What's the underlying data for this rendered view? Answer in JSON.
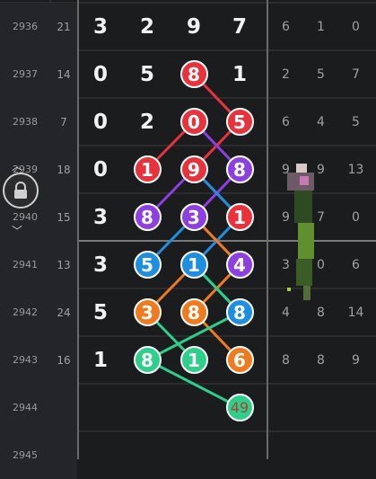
{
  "rows": [
    {
      "period": "2936",
      "sum": "21",
      "digits": [
        "3",
        "2",
        "9",
        "7"
      ],
      "ext": [
        "6",
        "1",
        "0"
      ]
    },
    {
      "period": "2937",
      "sum": "14",
      "digits": [
        "0",
        "5",
        "8",
        "1"
      ],
      "ext": [
        "2",
        "5",
        "7"
      ]
    },
    {
      "period": "2938",
      "sum": "7",
      "digits": [
        "0",
        "2",
        "0",
        "5"
      ],
      "ext": [
        "6",
        "4",
        "5"
      ]
    },
    {
      "period": "2939",
      "sum": "18",
      "digits": [
        "0",
        "1",
        "9",
        "8"
      ],
      "ext": [
        "9",
        "9",
        "13"
      ]
    },
    {
      "period": "2940",
      "sum": "15",
      "digits": [
        "3",
        "8",
        "3",
        "1"
      ],
      "ext": [
        "9",
        "7",
        "0"
      ]
    },
    {
      "period": "2941",
      "sum": "13",
      "digits": [
        "3",
        "5",
        "1",
        "4"
      ],
      "ext": [
        "3",
        "0",
        "6"
      ]
    },
    {
      "period": "2942",
      "sum": "24",
      "digits": [
        "5",
        "3",
        "8",
        "8"
      ],
      "ext": [
        "4",
        "8",
        "14"
      ]
    },
    {
      "period": "2943",
      "sum": "16",
      "digits": [
        "1",
        "8",
        "1",
        "6"
      ],
      "ext": [
        "8",
        "8",
        "9"
      ]
    },
    {
      "period": "2944",
      "sum": "",
      "digits": [
        "",
        "",
        "",
        "49"
      ],
      "ext": [
        "",
        "",
        ""
      ]
    },
    {
      "period": "2945",
      "sum": "",
      "digits": [
        "",
        "",
        "",
        ""
      ],
      "ext": [
        "",
        "",
        ""
      ]
    }
  ],
  "balls": [
    {
      "row": 1,
      "col": 2,
      "label": "8",
      "color": "#e8323c"
    },
    {
      "row": 2,
      "col": 2,
      "label": "0",
      "color": "#e8323c"
    },
    {
      "row": 2,
      "col": 3,
      "label": "5",
      "color": "#e8323c"
    },
    {
      "row": 3,
      "col": 1,
      "label": "1",
      "color": "#e8323c"
    },
    {
      "row": 3,
      "col": 2,
      "label": "9",
      "color": "#e8323c"
    },
    {
      "row": 3,
      "col": 3,
      "label": "8",
      "color": "#8e3fe0"
    },
    {
      "row": 4,
      "col": 1,
      "label": "8",
      "color": "#8e3fe0"
    },
    {
      "row": 4,
      "col": 2,
      "label": "3",
      "color": "#8e3fe0"
    },
    {
      "row": 4,
      "col": 3,
      "label": "1",
      "color": "#e8323c"
    },
    {
      "row": 5,
      "col": 1,
      "label": "5",
      "color": "#1e8ee0"
    },
    {
      "row": 5,
      "col": 2,
      "label": "1",
      "color": "#1e8ee0"
    },
    {
      "row": 5,
      "col": 3,
      "label": "4",
      "color": "#8e3fe0"
    },
    {
      "row": 6,
      "col": 1,
      "label": "3",
      "color": "#f07a1e"
    },
    {
      "row": 6,
      "col": 2,
      "label": "8",
      "color": "#f07a1e"
    },
    {
      "row": 6,
      "col": 3,
      "label": "8",
      "color": "#1e8ee0"
    },
    {
      "row": 7,
      "col": 1,
      "label": "8",
      "color": "#2ecf8a"
    },
    {
      "row": 7,
      "col": 2,
      "label": "1",
      "color": "#2ecf8a"
    },
    {
      "row": 7,
      "col": 3,
      "label": "6",
      "color": "#f07a1e"
    },
    {
      "row": 8,
      "col": 3,
      "label": "49",
      "color": "#2ecf8a",
      "bottom": true
    }
  ],
  "lines": [
    {
      "color": "#e8323c",
      "pts": [
        [
          1,
          2
        ],
        [
          2,
          3
        ],
        [
          3,
          2
        ],
        [
          4,
          3
        ]
      ]
    },
    {
      "color": "#e8323c",
      "pts": [
        [
          2,
          2
        ],
        [
          3,
          1
        ]
      ]
    },
    {
      "color": "#8e3fe0",
      "pts": [
        [
          2,
          2
        ],
        [
          3,
          3
        ],
        [
          4,
          2
        ],
        [
          5,
          3
        ]
      ]
    },
    {
      "color": "#8e3fe0",
      "pts": [
        [
          3,
          2
        ],
        [
          4,
          1
        ]
      ]
    },
    {
      "color": "#1e8ee0",
      "pts": [
        [
          3,
          2
        ],
        [
          4,
          3
        ],
        [
          5,
          2
        ],
        [
          6,
          3
        ]
      ]
    },
    {
      "color": "#1e8ee0",
      "pts": [
        [
          4,
          2
        ],
        [
          5,
          1
        ]
      ]
    },
    {
      "color": "#f07a1e",
      "pts": [
        [
          4,
          2
        ],
        [
          5,
          3
        ],
        [
          6,
          2
        ],
        [
          7,
          3
        ]
      ]
    },
    {
      "color": "#f07a1e",
      "pts": [
        [
          5,
          2
        ],
        [
          6,
          1
        ]
      ]
    },
    {
      "color": "#2ecf8a",
      "pts": [
        [
          5,
          2
        ],
        [
          6,
          3
        ],
        [
          7,
          1
        ],
        [
          8,
          3
        ]
      ]
    },
    {
      "color": "#2ecf8a",
      "pts": [
        [
          6,
          1
        ],
        [
          7,
          2
        ]
      ]
    }
  ]
}
